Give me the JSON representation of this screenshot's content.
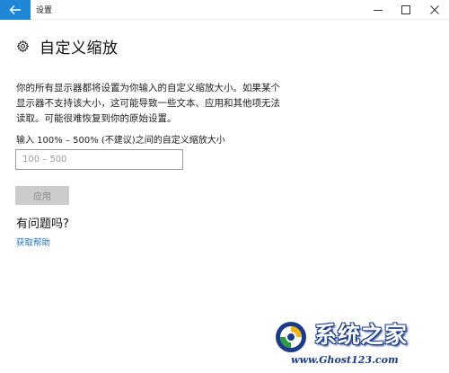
{
  "window": {
    "title": "设置",
    "back_icon": "back-arrow-icon",
    "minimize_icon": "minimize-icon",
    "maximize_icon": "maximize-icon",
    "close_icon": "close-icon",
    "accent_color": "#1f86d6"
  },
  "page": {
    "icon": "gear-icon",
    "title": "自定义缩放",
    "description": "你的所有显示器都将设置为你输入的自定义缩放大小。如果某个显示器不支持该大小，这可能导致一些文本、应用和其他项无法读取。可能很难恢复到你的原始设置。",
    "field_label": "输入 100% – 500% (不建议)之间的自定义缩放大小",
    "input_placeholder": "100 – 500",
    "input_value": "",
    "apply_label": "应用",
    "question": "有问题吗?",
    "help_link": "获取帮助"
  },
  "watermark": {
    "title": "系统之家",
    "url": "www.Ghost123.com"
  }
}
